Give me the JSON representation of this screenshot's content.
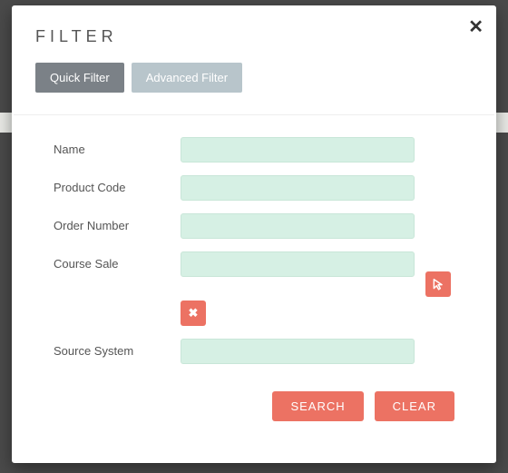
{
  "title": "FILTER",
  "tabs": {
    "quick": "Quick Filter",
    "advanced": "Advanced Filter"
  },
  "fields": {
    "name": {
      "label": "Name",
      "value": ""
    },
    "productCode": {
      "label": "Product Code",
      "value": ""
    },
    "orderNumber": {
      "label": "Order Number",
      "value": ""
    },
    "courseSale": {
      "label": "Course Sale",
      "value": ""
    },
    "sourceSystem": {
      "label": "Source System",
      "value": ""
    }
  },
  "buttons": {
    "search": "SEARCH",
    "clear": "CLEAR"
  },
  "icons": {
    "close": "✕",
    "remove": "✖",
    "pointer": "pointer"
  }
}
